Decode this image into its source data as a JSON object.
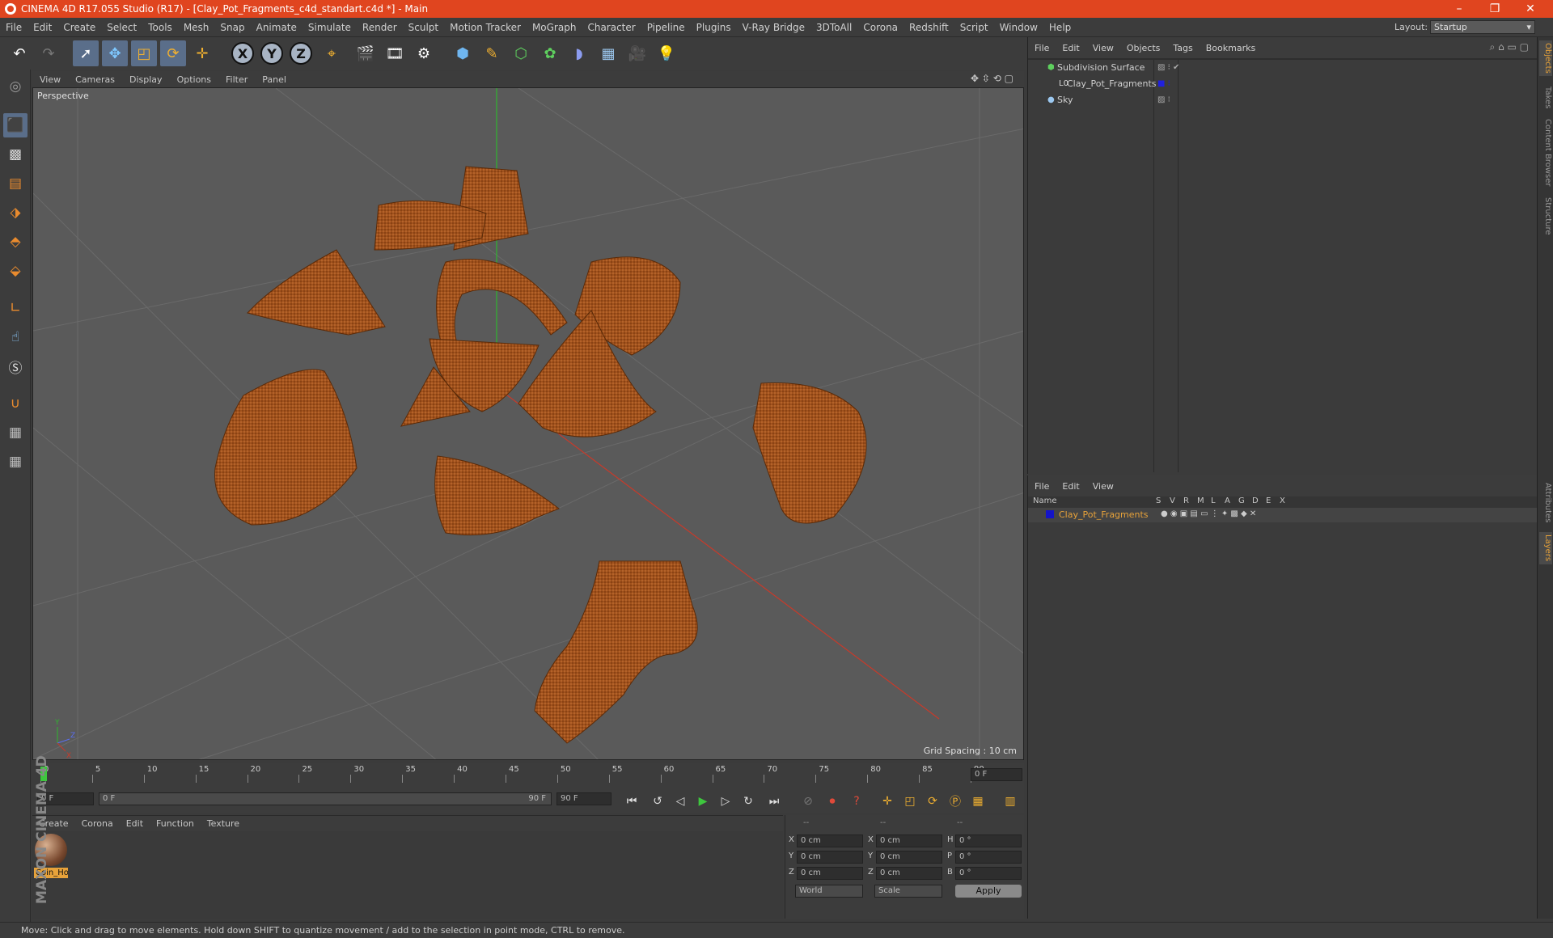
{
  "window": {
    "title": "CINEMA 4D R17.055 Studio (R17) - [Clay_Pot_Fragments_c4d_standart.c4d *] - Main",
    "minimize": "–",
    "restore": "❐",
    "close": "✕"
  },
  "menubar": [
    "File",
    "Edit",
    "Create",
    "Select",
    "Tools",
    "Mesh",
    "Snap",
    "Animate",
    "Simulate",
    "Render",
    "Sculpt",
    "Motion Tracker",
    "MoGraph",
    "Character",
    "Pipeline",
    "Plugins",
    "V-Ray Bridge",
    "3DToAll",
    "Corona",
    "Redshift",
    "Script",
    "Window",
    "Help"
  ],
  "layout": {
    "label": "Layout:",
    "value": "Startup"
  },
  "viewport": {
    "menu": [
      "View",
      "Cameras",
      "Display",
      "Options",
      "Filter",
      "Panel"
    ],
    "label": "Perspective",
    "grid": "Grid Spacing : 10 cm"
  },
  "timeline": {
    "ticks": [
      "0",
      "5",
      "10",
      "15",
      "20",
      "25",
      "30",
      "35",
      "40",
      "45",
      "50",
      "55",
      "60",
      "65",
      "70",
      "75",
      "80",
      "85",
      "90"
    ],
    "frame_field": "0 F"
  },
  "playback": {
    "start": "0 F",
    "range_start": "0 F",
    "range_end": "90 F",
    "end": "90 F"
  },
  "material_menu": [
    "Create",
    "Corona",
    "Edit",
    "Function",
    "Texture"
  ],
  "material": {
    "name": "Coin_Ho"
  },
  "coords": {
    "head": [
      "--",
      "--",
      "--"
    ],
    "rows": [
      {
        "a": "X",
        "v1": "0 cm",
        "b": "X",
        "v2": "0 cm",
        "c": "H",
        "v3": "0 °"
      },
      {
        "a": "Y",
        "v1": "0 cm",
        "b": "Y",
        "v2": "0 cm",
        "c": "P",
        "v3": "0 °"
      },
      {
        "a": "Z",
        "v1": "0 cm",
        "b": "Z",
        "v2": "0 cm",
        "c": "B",
        "v3": "0 °"
      }
    ],
    "world": "World",
    "scale": "Scale",
    "apply": "Apply"
  },
  "objects": {
    "menu": [
      "File",
      "Edit",
      "View",
      "Objects",
      "Tags",
      "Bookmarks"
    ],
    "items": [
      {
        "name": "Subdivision Surface"
      },
      {
        "name": "Clay_Pot_Fragments"
      },
      {
        "name": "Sky"
      }
    ]
  },
  "layers": {
    "menu": [
      "File",
      "Edit",
      "View"
    ],
    "header_name": "Name",
    "cols": [
      "S",
      "V",
      "R",
      "M",
      "L",
      "A",
      "G",
      "D",
      "E",
      "X"
    ],
    "items": [
      {
        "name": "Clay_Pot_Fragments"
      }
    ]
  },
  "side_tabs": [
    "Objects",
    "Takes",
    "Content Browser",
    "Structure"
  ],
  "side_tabs2": [
    "Attributes",
    "Layers"
  ],
  "brand": "MAXON CINEMA 4D",
  "status": "Move: Click and drag to move elements. Hold down SHIFT to quantize movement / add to the selection in point mode, CTRL to remove.",
  "colors": {
    "title": "#e0451f",
    "accent": "#e7a23a",
    "selected": "#5a6e8a"
  }
}
